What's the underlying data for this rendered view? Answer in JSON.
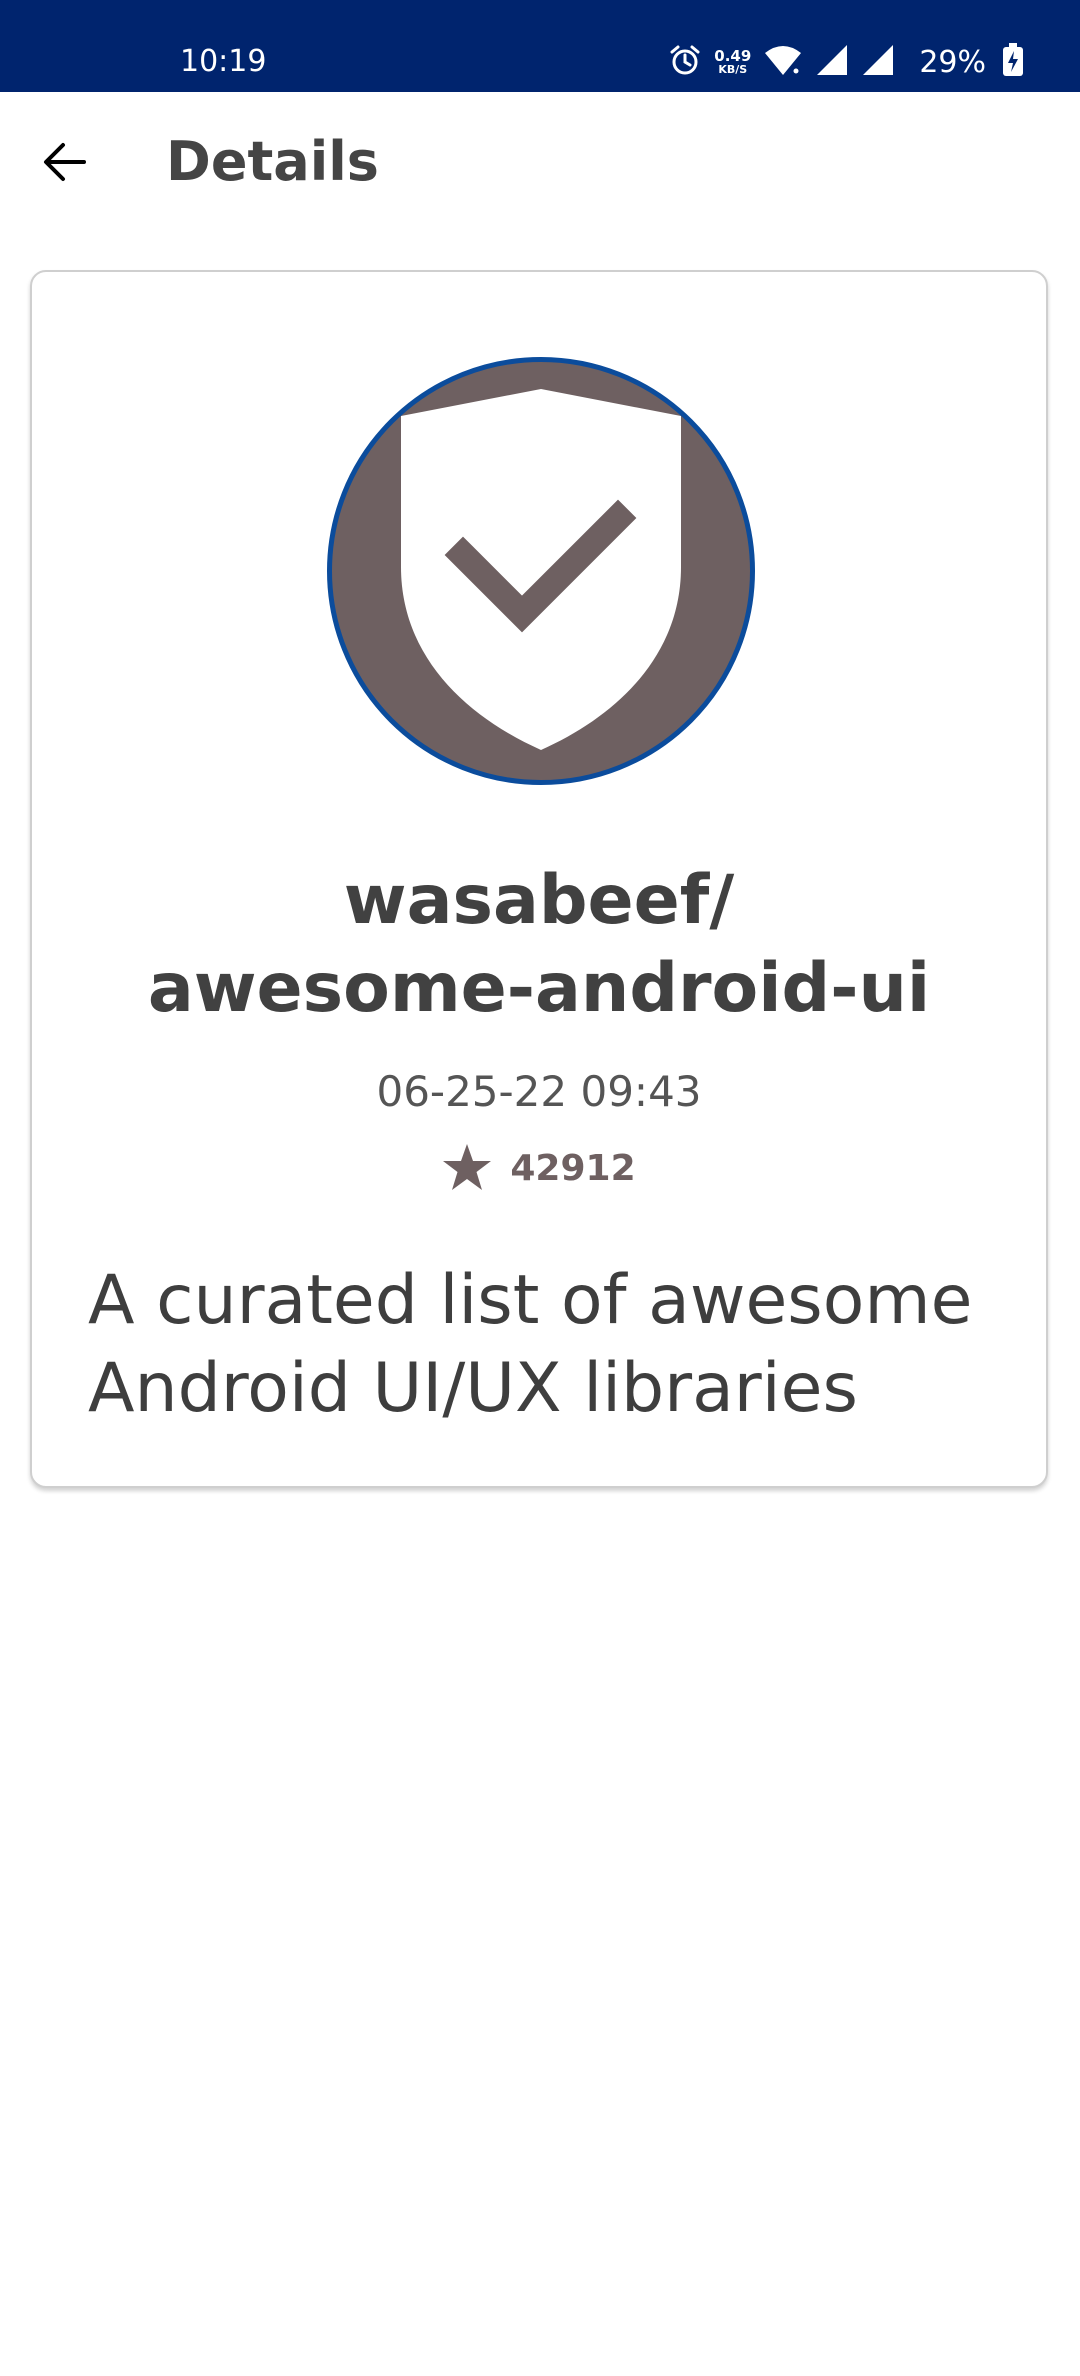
{
  "status_bar": {
    "time": "10:19",
    "net_speed_value": "0.49",
    "net_speed_unit": "KB/S",
    "battery_percent": "29%",
    "icons": [
      "alarm-icon",
      "wifi-icon",
      "signal-icon",
      "signal-icon",
      "battery-charging-icon"
    ],
    "background_color": "#00246e"
  },
  "app_bar": {
    "title": "Details",
    "back_icon": "arrow-back-icon"
  },
  "repo": {
    "owner_line": "wasabeef/",
    "name_line": "awesome-android-ui",
    "updated_at": "06-25-22 09:43",
    "stars": "42912",
    "description": "A curated list of awesome Android UI/UX libraries",
    "avatar_icon": "shield-check-icon"
  },
  "colors": {
    "accent": "#0b4c9c",
    "avatar_background": "#6e6061",
    "text_primary": "#414141"
  }
}
